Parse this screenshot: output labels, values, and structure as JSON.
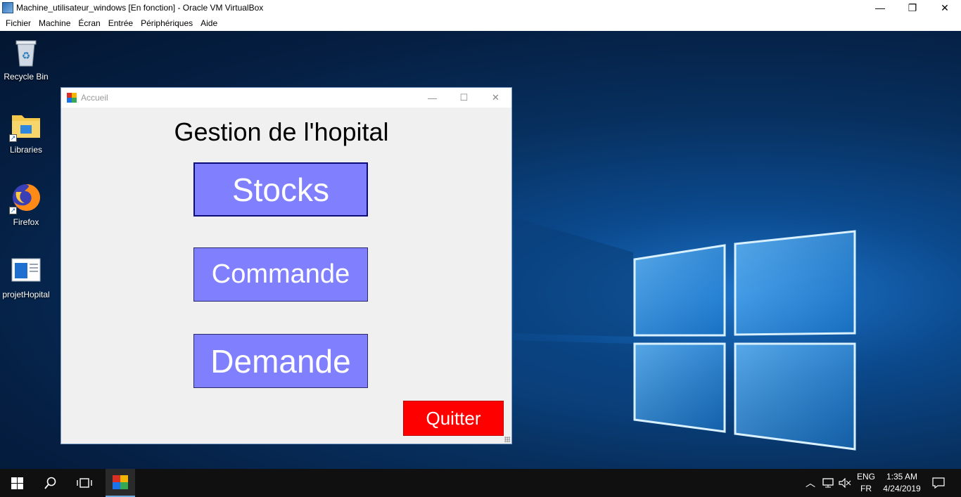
{
  "host": {
    "title": "Machine_utilisateur_windows [En fonction] - Oracle VM VirtualBox",
    "controls": {
      "minimize": "—",
      "restore": "❐",
      "close": "✕"
    },
    "menu": [
      "Fichier",
      "Machine",
      "Écran",
      "Entrée",
      "Périphériques",
      "Aide"
    ]
  },
  "desktop_icons": [
    {
      "label": "Recycle Bin",
      "icon": "recycle-bin-icon"
    },
    {
      "label": "Libraries",
      "icon": "folder-icon"
    },
    {
      "label": "Firefox",
      "icon": "firefox-icon"
    },
    {
      "label": "projetHopital",
      "icon": "app-shortcut-icon"
    }
  ],
  "app": {
    "title": "Accueil",
    "controls": {
      "minimize": "—",
      "maximize": "☐",
      "close": "✕"
    },
    "heading": "Gestion de l'hopital",
    "buttons": {
      "stocks": "Stocks",
      "commande": "Commande",
      "demande": "Demande",
      "quit": "Quitter"
    },
    "colors": {
      "button": "#8080ff",
      "quit": "#ff0000"
    }
  },
  "taskbar": {
    "language": "ENG",
    "layout": "FR",
    "time": "1:35 AM",
    "date": "4/24/2019"
  }
}
